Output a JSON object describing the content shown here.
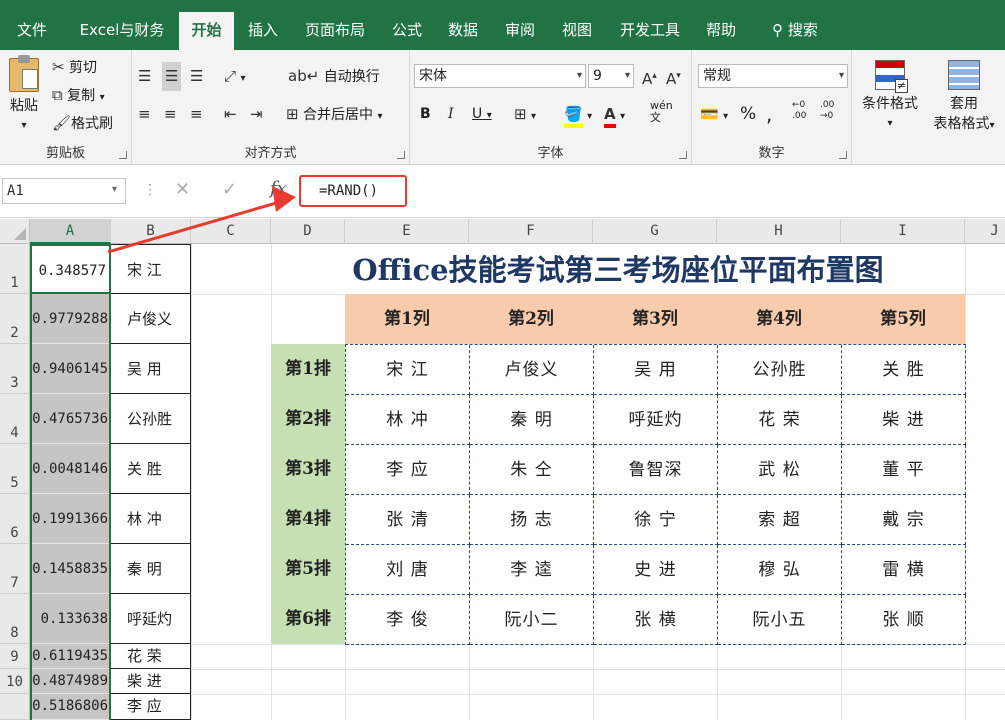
{
  "menu": {
    "tabs": [
      "文件",
      "Excel与财务",
      "开始",
      "插入",
      "页面布局",
      "公式",
      "数据",
      "审阅",
      "视图",
      "开发工具",
      "帮助"
    ],
    "search": "搜索"
  },
  "ribbon": {
    "clipboard": {
      "label": "剪贴板",
      "paste": "粘贴",
      "cut": "剪切",
      "copy": "复制",
      "format_painter": "格式刷"
    },
    "alignment": {
      "label": "对齐方式",
      "wrap": "自动换行",
      "merge": "合并后居中"
    },
    "font": {
      "label": "字体",
      "name": "宋体",
      "size": "9"
    },
    "number": {
      "label": "数字",
      "format": "常规"
    },
    "styles": {
      "cond": "条件格式",
      "table1": "套用",
      "table2": "表格格式"
    }
  },
  "formula_bar": {
    "name_box": "A1",
    "formula": "=RAND()"
  },
  "columns": [
    "A",
    "B",
    "C",
    "D",
    "E",
    "F",
    "G",
    "H",
    "I",
    "J"
  ],
  "rows": [
    "1",
    "2",
    "3",
    "4",
    "5",
    "6",
    "7",
    "8",
    "9",
    "10"
  ],
  "random_values": [
    "0.348577",
    "0.9779288",
    "0.9406145",
    "0.4765736",
    "0.0048146",
    "0.1991366",
    "0.1458835",
    "0.133638",
    "0.6119435",
    "0.4874989",
    "0.5186806"
  ],
  "names_col_b": [
    "宋 江",
    "卢俊义",
    "吴 用",
    "公孙胜",
    "关 胜",
    "林 冲",
    "秦 明",
    "呼延灼",
    "花 荣",
    "柴 进",
    "李 应"
  ],
  "seating": {
    "title": "Office技能考试第三考场座位平面布置图",
    "col_headers": [
      "第1列",
      "第2列",
      "第3列",
      "第4列",
      "第5列"
    ],
    "row_labels": [
      "第1排",
      "第2排",
      "第3排",
      "第4排",
      "第5排",
      "第6排"
    ],
    "seats": [
      [
        "宋 江",
        "卢俊义",
        "吴 用",
        "公孙胜",
        "关 胜"
      ],
      [
        "林 冲",
        "秦 明",
        "呼延灼",
        "花 荣",
        "柴 进"
      ],
      [
        "李 应",
        "朱 仝",
        "鲁智深",
        "武 松",
        "董 平"
      ],
      [
        "张 清",
        "扬 志",
        "徐 宁",
        "索 超",
        "戴 宗"
      ],
      [
        "刘 唐",
        "李 逵",
        "史 进",
        "穆 弘",
        "雷 横"
      ],
      [
        "李 俊",
        "阮小二",
        "张 横",
        "阮小五",
        "张 顺"
      ]
    ]
  },
  "colors": {
    "excel_green": "#217346",
    "highlight_red": "#e83a2f",
    "header_fill": "#f8cbad",
    "row_fill": "#c6e0b4"
  }
}
